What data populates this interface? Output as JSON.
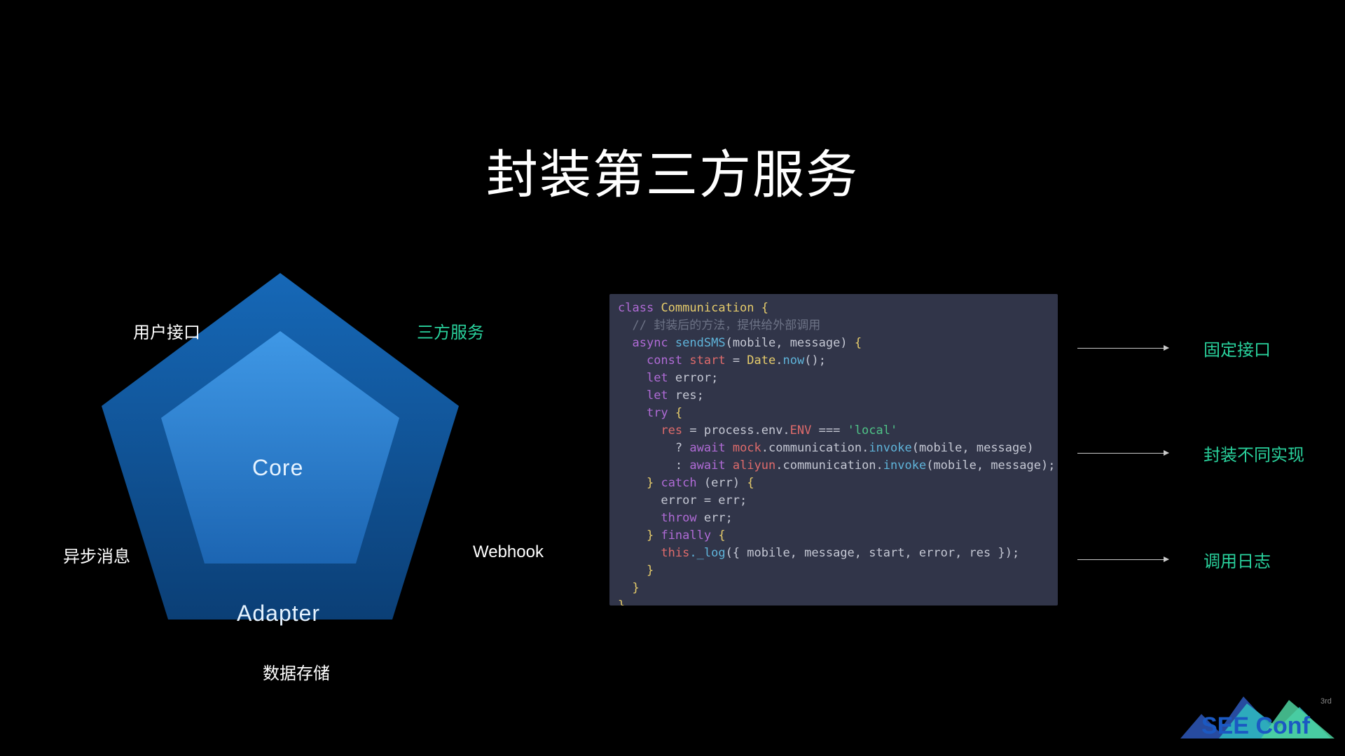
{
  "title": "封装第三方服务",
  "pentagon": {
    "core": "Core",
    "adapter": "Adapter",
    "labels": {
      "user_iface": "用户接口",
      "third_party": "三方服务",
      "async_msg": "异步消息",
      "webhook": "Webhook",
      "data_store": "数据存储"
    }
  },
  "annotations": {
    "fixed_iface": "固定接口",
    "wrap_impl": "封装不同实现",
    "call_log": "调用日志"
  },
  "code": {
    "line1_kw_class": "class",
    "line1_name": "Communication",
    "line2_comment": "// 封装后的方法，提供给外部调用",
    "line3_async": "async",
    "line3_fn": "sendSMS",
    "line3_args": "(mobile, message)",
    "line4_kw": "const",
    "line4_id": "start",
    "line4_rhs": "Date.now();",
    "line5": "let error;",
    "line6": "let res;",
    "line7_try": "try",
    "line8_id": "res",
    "line8_rhs_a": " = process.env.",
    "line8_env": "ENV",
    "line8_rhs_b": " === ",
    "line8_str": "'local'",
    "line9_q": "?",
    "line9_await": "await",
    "line9_obj": "mock",
    "line9_rest": ".communication.",
    "line9_fn": "invoke",
    "line9_args": "(mobile, message)",
    "line10_q": ":",
    "line10_await": "await",
    "line10_obj": "aliyun",
    "line10_rest": ".communication.",
    "line10_fn": "invoke",
    "line10_args": "(mobile, message);",
    "line11_catch": "catch",
    "line11_err": "(err)",
    "line12": "error = err;",
    "line13_throw": "throw",
    "line13_err": "err;",
    "line14_finally": "finally",
    "line15_this": "this",
    "line15_fn": "._log",
    "line15_args": "({ mobile, message, start, error, res });"
  },
  "logo": {
    "text": "SEE Conf",
    "sub": "3rd"
  }
}
